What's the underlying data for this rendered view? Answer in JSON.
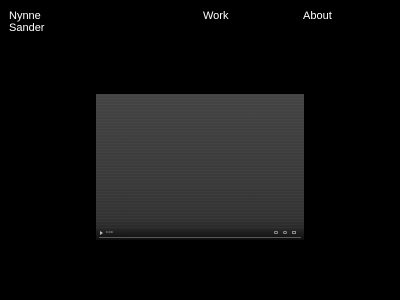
{
  "header": {
    "brand_line1": "Nynne",
    "brand_line2": "Sander",
    "nav": {
      "work": "Work",
      "about": "About"
    }
  },
  "video": {
    "time": "0:00",
    "progress": 0,
    "icons": {
      "play": "play-icon",
      "volume": "volume-icon",
      "settings": "settings-icon",
      "fullscreen": "fullscreen-icon"
    }
  },
  "colors": {
    "background": "#000000",
    "text": "#ffffff",
    "video_bg": "#3a3a3a"
  }
}
